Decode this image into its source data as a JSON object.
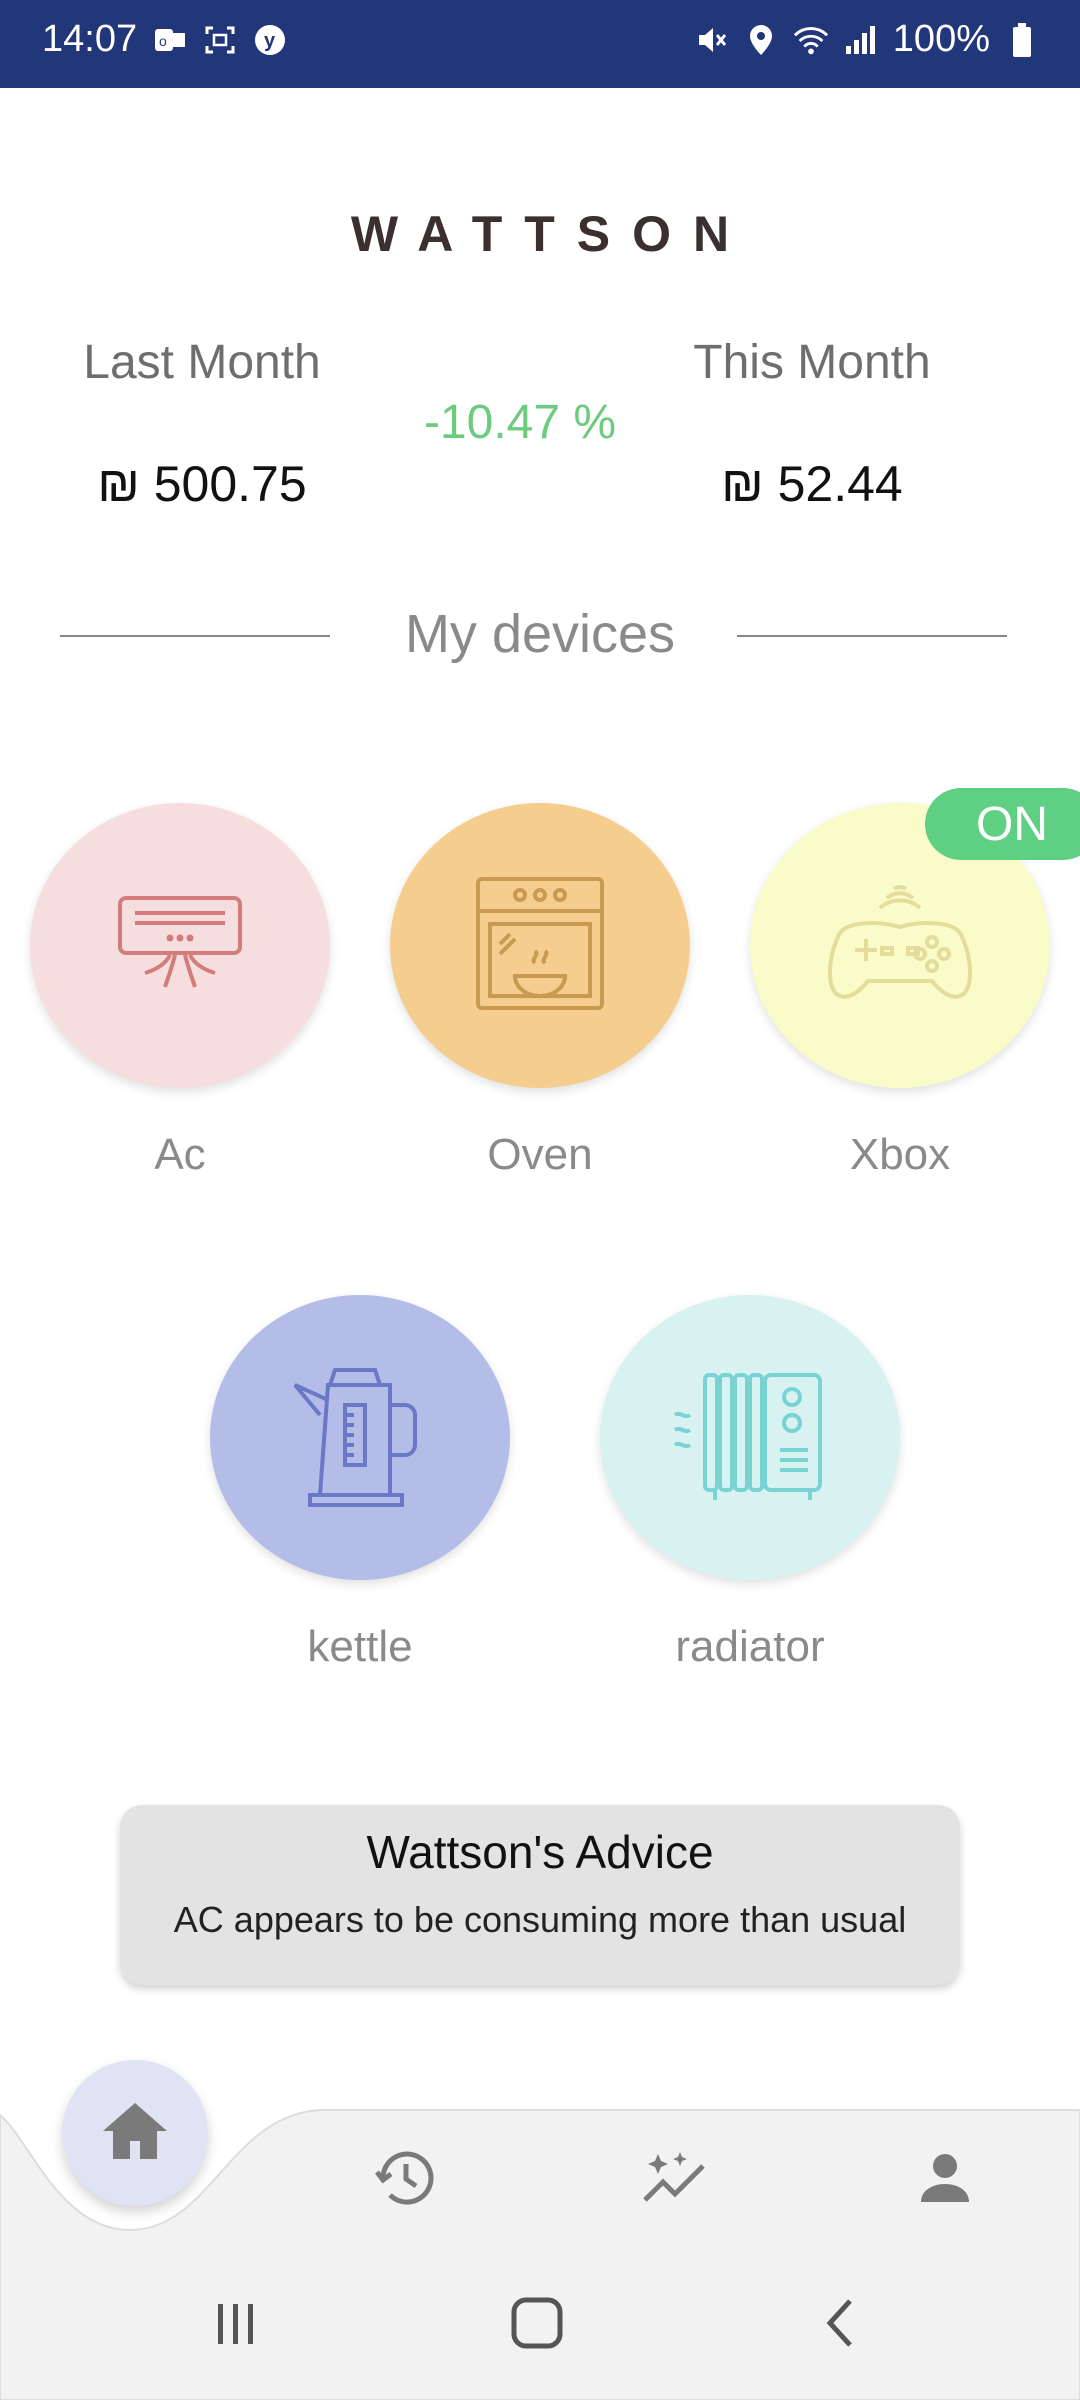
{
  "status_bar": {
    "time": "14:07",
    "battery": "100%",
    "left_icons": [
      "outlook-icon",
      "screen-capture-icon",
      "yahoo-icon"
    ],
    "right_icons": [
      "mute-icon",
      "location-icon",
      "wifi-icon",
      "signal-icon",
      "battery-icon"
    ]
  },
  "header": {
    "title": "WATTSON"
  },
  "summary": {
    "last_month_label": "Last Month",
    "last_month_value": "₪ 500.75",
    "this_month_label": "This Month",
    "this_month_value": "₪ 52.44",
    "change": "-10.47 %",
    "change_color": "#6ccb7e"
  },
  "section": {
    "title": "My devices"
  },
  "devices": [
    {
      "label": "Ac",
      "icon": "air-conditioner-icon",
      "color": "#f7dede",
      "icon_color": "#d47c7c",
      "on": false
    },
    {
      "label": "Oven",
      "icon": "oven-icon",
      "color": "#f5cd8f",
      "icon_color": "#c99a52",
      "on": false
    },
    {
      "label": "Xbox",
      "icon": "gamepad-icon",
      "color": "#f9fbc9",
      "icon_color": "#e3dc9a",
      "on": true
    },
    {
      "label": "kettle",
      "icon": "kettle-icon",
      "color": "#b3bde8",
      "icon_color": "#6b78c6",
      "on": false
    },
    {
      "label": "radiator",
      "icon": "radiator-icon",
      "color": "#d8f1f1",
      "icon_color": "#79d3d3",
      "on": false
    }
  ],
  "on_badge": "ON",
  "advice": {
    "title": "Wattson's Advice",
    "message": "AC appears to be consuming more than usual"
  },
  "bottom_nav": {
    "items": [
      "home-icon",
      "history-icon",
      "insights-icon",
      "profile-icon"
    ],
    "active": "home-icon"
  },
  "system_nav": [
    "recent-apps-icon",
    "home-circle-icon",
    "back-icon"
  ]
}
